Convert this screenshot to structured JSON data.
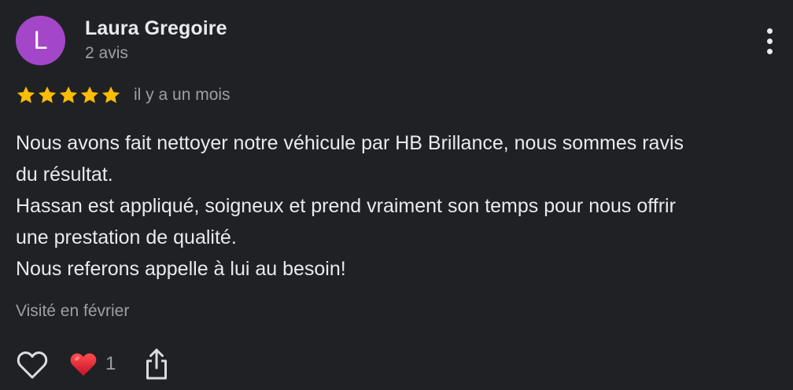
{
  "review": {
    "author": {
      "initial": "L",
      "name": "Laura Gregoire",
      "meta": "2 avis",
      "avatar_color": "#a347c8"
    },
    "more_icon": "more-vert-icon",
    "rating": 5,
    "max_rating": 5,
    "star_color": "#fbbc04",
    "date": "il y a un mois",
    "text_lines": [
      "Nous avons fait nettoyer notre véhicule par HB Brillance, nous sommes ravis",
      "du résultat.",
      "Hassan est appliqué, soigneux et prend vraiment son temps pour nous offrir",
      "une prestation de qualité.",
      "Nous referons appelle à lui au besoin!"
    ],
    "visit": "Visité en février",
    "actions": {
      "like_icon": "heart-outline-icon",
      "reaction_icon": "red-heart-icon",
      "reaction_count": "1",
      "share_icon": "share-icon"
    }
  }
}
